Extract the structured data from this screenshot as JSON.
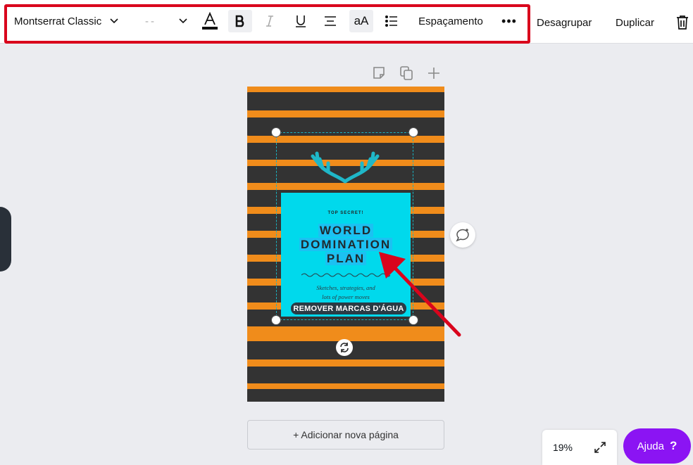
{
  "toolbar": {
    "font_name": "Montserrat Classic",
    "font_size": "--",
    "spacing_label": "Espaçamento",
    "case_label": "aA",
    "more_label": "•••"
  },
  "actions": {
    "ungroup_label": "Desagrupar",
    "duplicate_label": "Duplicar"
  },
  "design": {
    "top_secret": "TOP SECRET!",
    "title_line1": "WORLD",
    "title_line2": "DOMINATION",
    "title_line3": "PLAN",
    "subtitle_line1": "Sketches, strategies, and",
    "subtitle_line2": "lots of power moves",
    "watermark_label": "REMOVER MARCAS D'ÁGUA"
  },
  "footer": {
    "add_page_label": "+ Adicionar nova página",
    "zoom_level": "19%",
    "help_label": "Ajuda",
    "help_icon": "?"
  },
  "colors": {
    "highlight_border": "#d9041c",
    "canvas_orange": "#f08c1b",
    "stripe_dark": "#333333",
    "card_cyan": "#00d9ec",
    "help_purple": "#8b14f3",
    "arrow_red": "#d9041c"
  },
  "icons": [
    "chevron-down-icon",
    "text-color-icon",
    "bold-icon",
    "italic-icon",
    "underline-icon",
    "align-center-icon",
    "list-icon",
    "trash-icon",
    "note-icon",
    "copy-icon",
    "plus-icon",
    "comment-icon",
    "rotate-icon",
    "expand-icon"
  ]
}
